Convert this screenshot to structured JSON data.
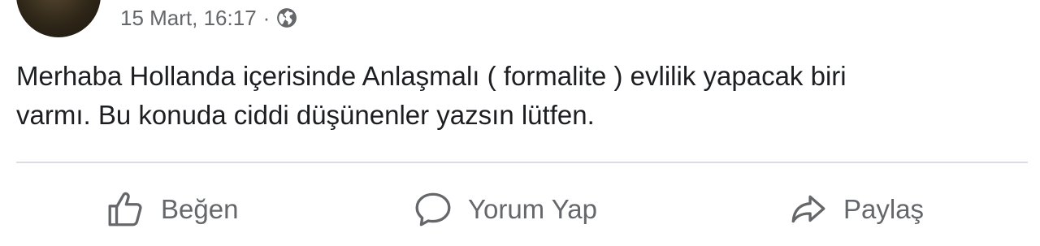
{
  "post": {
    "timestamp": "15 Mart, 16:17",
    "separator": "·",
    "privacy_icon": "globe-icon",
    "text": "Merhaba Hollanda içerisinde Anlaşmalı ( formalite ) evlilik yapacak biri\nvarmı. Bu konuda ciddi düşünenler yazsın lütfen."
  },
  "actions": {
    "like_label": "Beğen",
    "like_icon": "thumbs-up-icon",
    "comment_label": "Yorum Yap",
    "comment_icon": "speech-bubble-icon",
    "share_label": "Paylaş",
    "share_icon": "share-arrow-icon"
  },
  "colors": {
    "meta_text": "#65676b",
    "body_text": "#1c1e21",
    "divider": "#dadde1"
  }
}
